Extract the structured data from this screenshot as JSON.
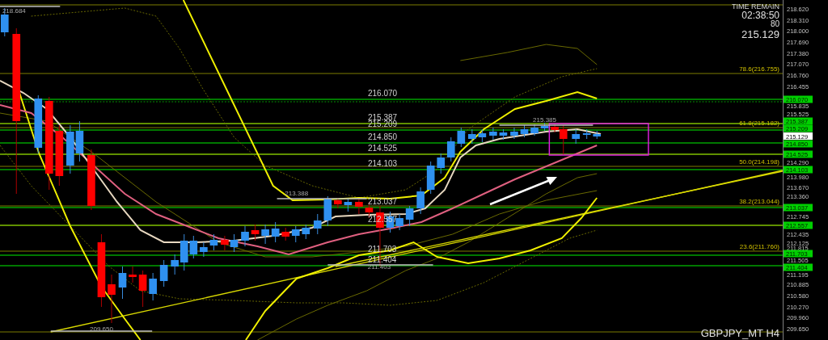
{
  "countdown": {
    "title": "TIME REMAIN",
    "time": "02:38:50",
    "value": "80",
    "price": "215.129"
  },
  "symbol": "GBPJPY_MT H4",
  "levels": [
    {
      "price": "216.070"
    },
    {
      "price": "215.387"
    },
    {
      "price": "215.209"
    },
    {
      "price": "214.850"
    },
    {
      "price": "214.525"
    },
    {
      "price": "214.103"
    },
    {
      "price": "213.037"
    },
    {
      "price": "212.557"
    },
    {
      "price": "211.703"
    },
    {
      "price": "211.404"
    }
  ],
  "fib_levels": [
    {
      "label": "78.6(216.755)"
    },
    {
      "label": "61.8(215.182)"
    },
    {
      "label": "50.0(214.198)"
    },
    {
      "label": "38.2(213.044)"
    },
    {
      "label": "23.6(211.760)"
    }
  ],
  "swing_marks": [
    {
      "text": "218.684"
    },
    {
      "text": "215.385"
    },
    {
      "text": "213.388"
    },
    {
      "text": "211.403"
    },
    {
      "text": "209.650"
    }
  ],
  "price_axis": {
    "ticks": [
      "218.620",
      "218.310",
      "218.000",
      "217.690",
      "217.380",
      "217.070",
      "216.760",
      "216.455",
      "215.835",
      "215.525",
      "214.290",
      "213.980",
      "213.670",
      "213.360",
      "212.745",
      "212.435",
      "212.125",
      "211.815",
      "211.505",
      "211.195",
      "210.885",
      "210.580",
      "210.270",
      "209.960",
      "209.650"
    ],
    "level_tags": [
      "216.070",
      "215.387",
      "215.209",
      "214.850",
      "214.525",
      "214.103",
      "213.037",
      "212.557",
      "211.703",
      "211.404"
    ],
    "current_price": "215.129"
  }
}
